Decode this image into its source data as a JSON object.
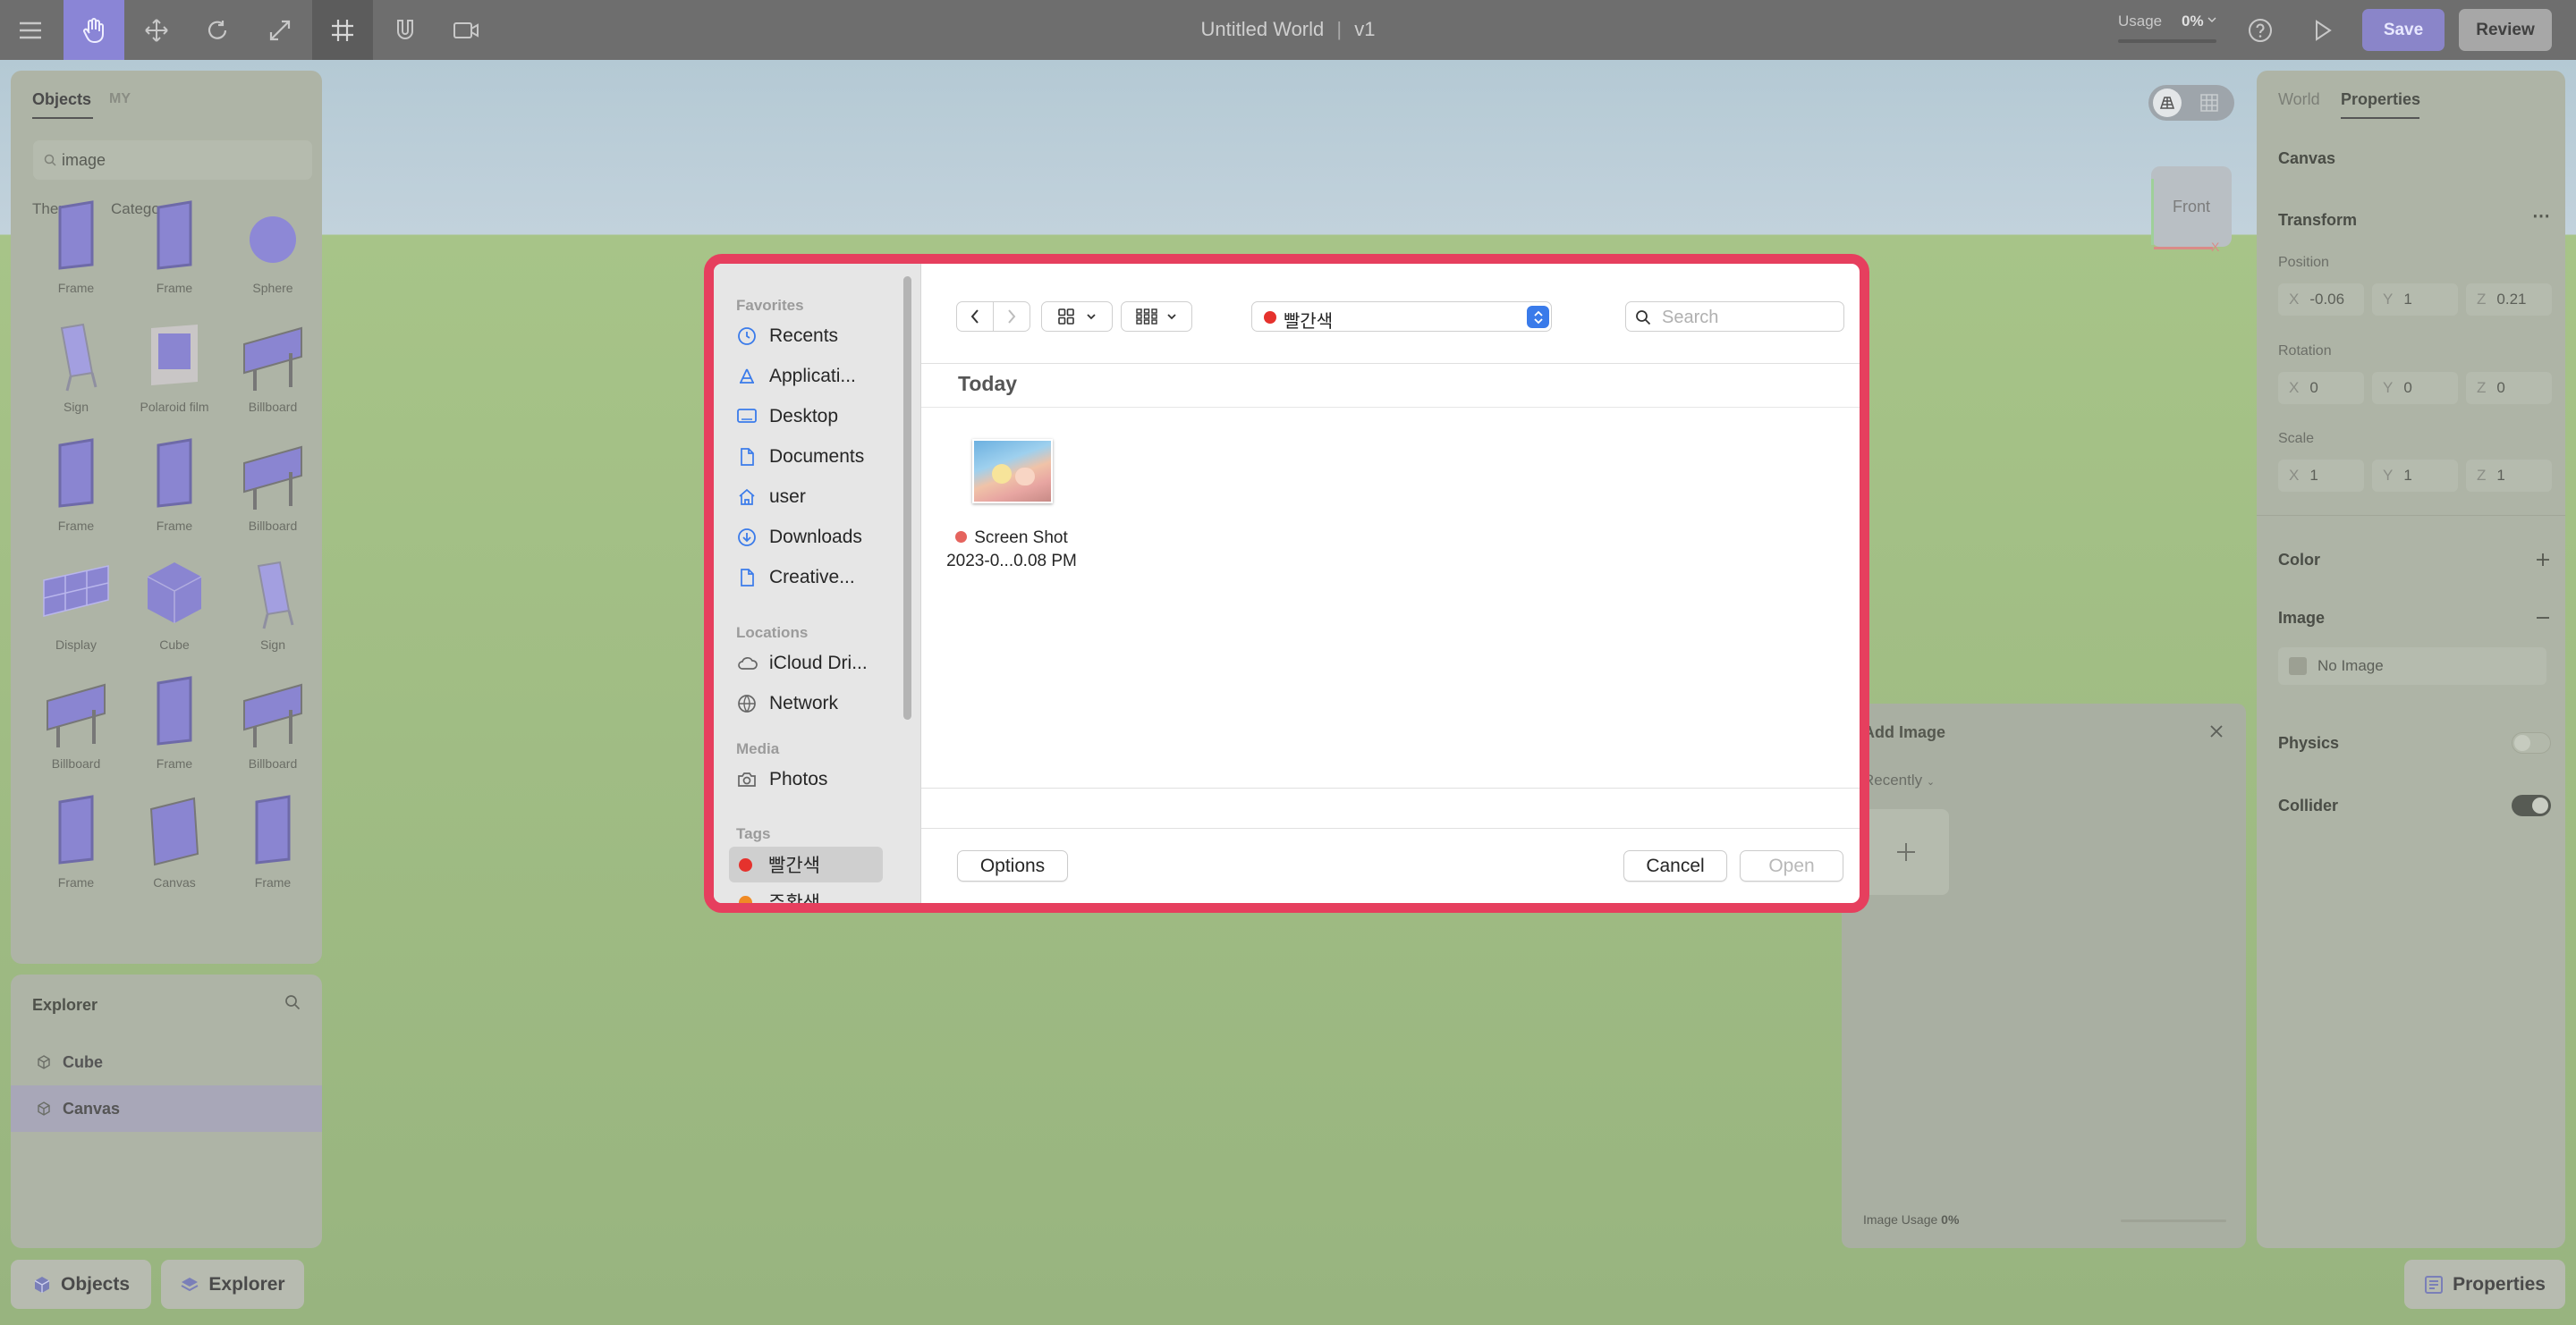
{
  "topbar": {
    "title": "Untitled World",
    "separator": "|",
    "version": "v1",
    "usage_label": "Usage",
    "usage_value": "0%",
    "save_label": "Save",
    "review_label": "Review",
    "tools": [
      "menu-icon",
      "hand-icon",
      "move-icon",
      "rotate-icon",
      "scale-icon",
      "grid-snap-icon",
      "magnet-icon",
      "camera-icon"
    ]
  },
  "objects_panel": {
    "tabs": [
      "Objects",
      "MY"
    ],
    "search_value": "image",
    "filters": [
      "Theme",
      "Category"
    ],
    "items": [
      "Frame",
      "Frame",
      "Sphere",
      "Sign",
      "Polaroid film",
      "Billboard",
      "Frame",
      "Frame",
      "Billboard",
      "Display",
      "Cube",
      "Sign",
      "Billboard",
      "Frame",
      "Billboard",
      "Frame",
      "Canvas",
      "Frame"
    ]
  },
  "explorer_panel": {
    "title": "Explorer",
    "items": [
      "Cube",
      "Canvas"
    ]
  },
  "bottom_buttons": {
    "objects": "Objects",
    "explorer": "Explorer",
    "properties": "Properties"
  },
  "properties_panel": {
    "tabs": [
      "World",
      "Properties"
    ],
    "object_name": "Canvas",
    "transform_label": "Transform",
    "position_label": "Position",
    "position": {
      "x": "-0.06",
      "y": "1",
      "z": "0.21"
    },
    "rotation_label": "Rotation",
    "rotation": {
      "x": "0",
      "y": "0",
      "z": "0"
    },
    "scale_label": "Scale",
    "scale": {
      "x": "1",
      "y": "1",
      "z": "1"
    },
    "axis_labels": [
      "X",
      "Y",
      "Z"
    ],
    "color_label": "Color",
    "image_label": "Image",
    "no_image": "No Image",
    "physics_label": "Physics",
    "physics_on": false,
    "collider_label": "Collider",
    "collider_on": true
  },
  "viewcube": {
    "face": "Front",
    "axis": "X"
  },
  "add_image_panel": {
    "title": "Add Image",
    "filter": "Recently",
    "usage_label": "Image Usage",
    "usage_value": "0%"
  },
  "dialog": {
    "sidebar": {
      "favorites_heading": "Favorites",
      "favorites": [
        {
          "label": "Recents",
          "icon": "clock-icon"
        },
        {
          "label": "Applicati...",
          "icon": "applications-icon"
        },
        {
          "label": "Desktop",
          "icon": "desktop-icon"
        },
        {
          "label": "Documents",
          "icon": "document-icon"
        },
        {
          "label": "user",
          "icon": "home-icon"
        },
        {
          "label": "Downloads",
          "icon": "download-icon"
        },
        {
          "label": "Creative...",
          "icon": "file-icon"
        }
      ],
      "locations_heading": "Locations",
      "locations": [
        {
          "label": "iCloud Dri...",
          "icon": "cloud-icon"
        },
        {
          "label": "Network",
          "icon": "globe-icon"
        }
      ],
      "media_heading": "Media",
      "media": [
        {
          "label": "Photos",
          "icon": "camera-icon"
        }
      ],
      "tags_heading": "Tags",
      "tags": [
        {
          "label": "빨간색",
          "color": "#e5322d"
        },
        {
          "label": "주황색",
          "color": "#f08a24"
        }
      ]
    },
    "current_folder": "빨간색",
    "folder_color": "#e5322d",
    "search_placeholder": "Search",
    "section_heading": "Today",
    "files": [
      {
        "name_line1": "Screen Shot",
        "name_line2": "2023-0...0.08 PM",
        "tag_color": "#e5645e"
      }
    ],
    "options_label": "Options",
    "cancel_label": "Cancel",
    "open_label": "Open"
  }
}
